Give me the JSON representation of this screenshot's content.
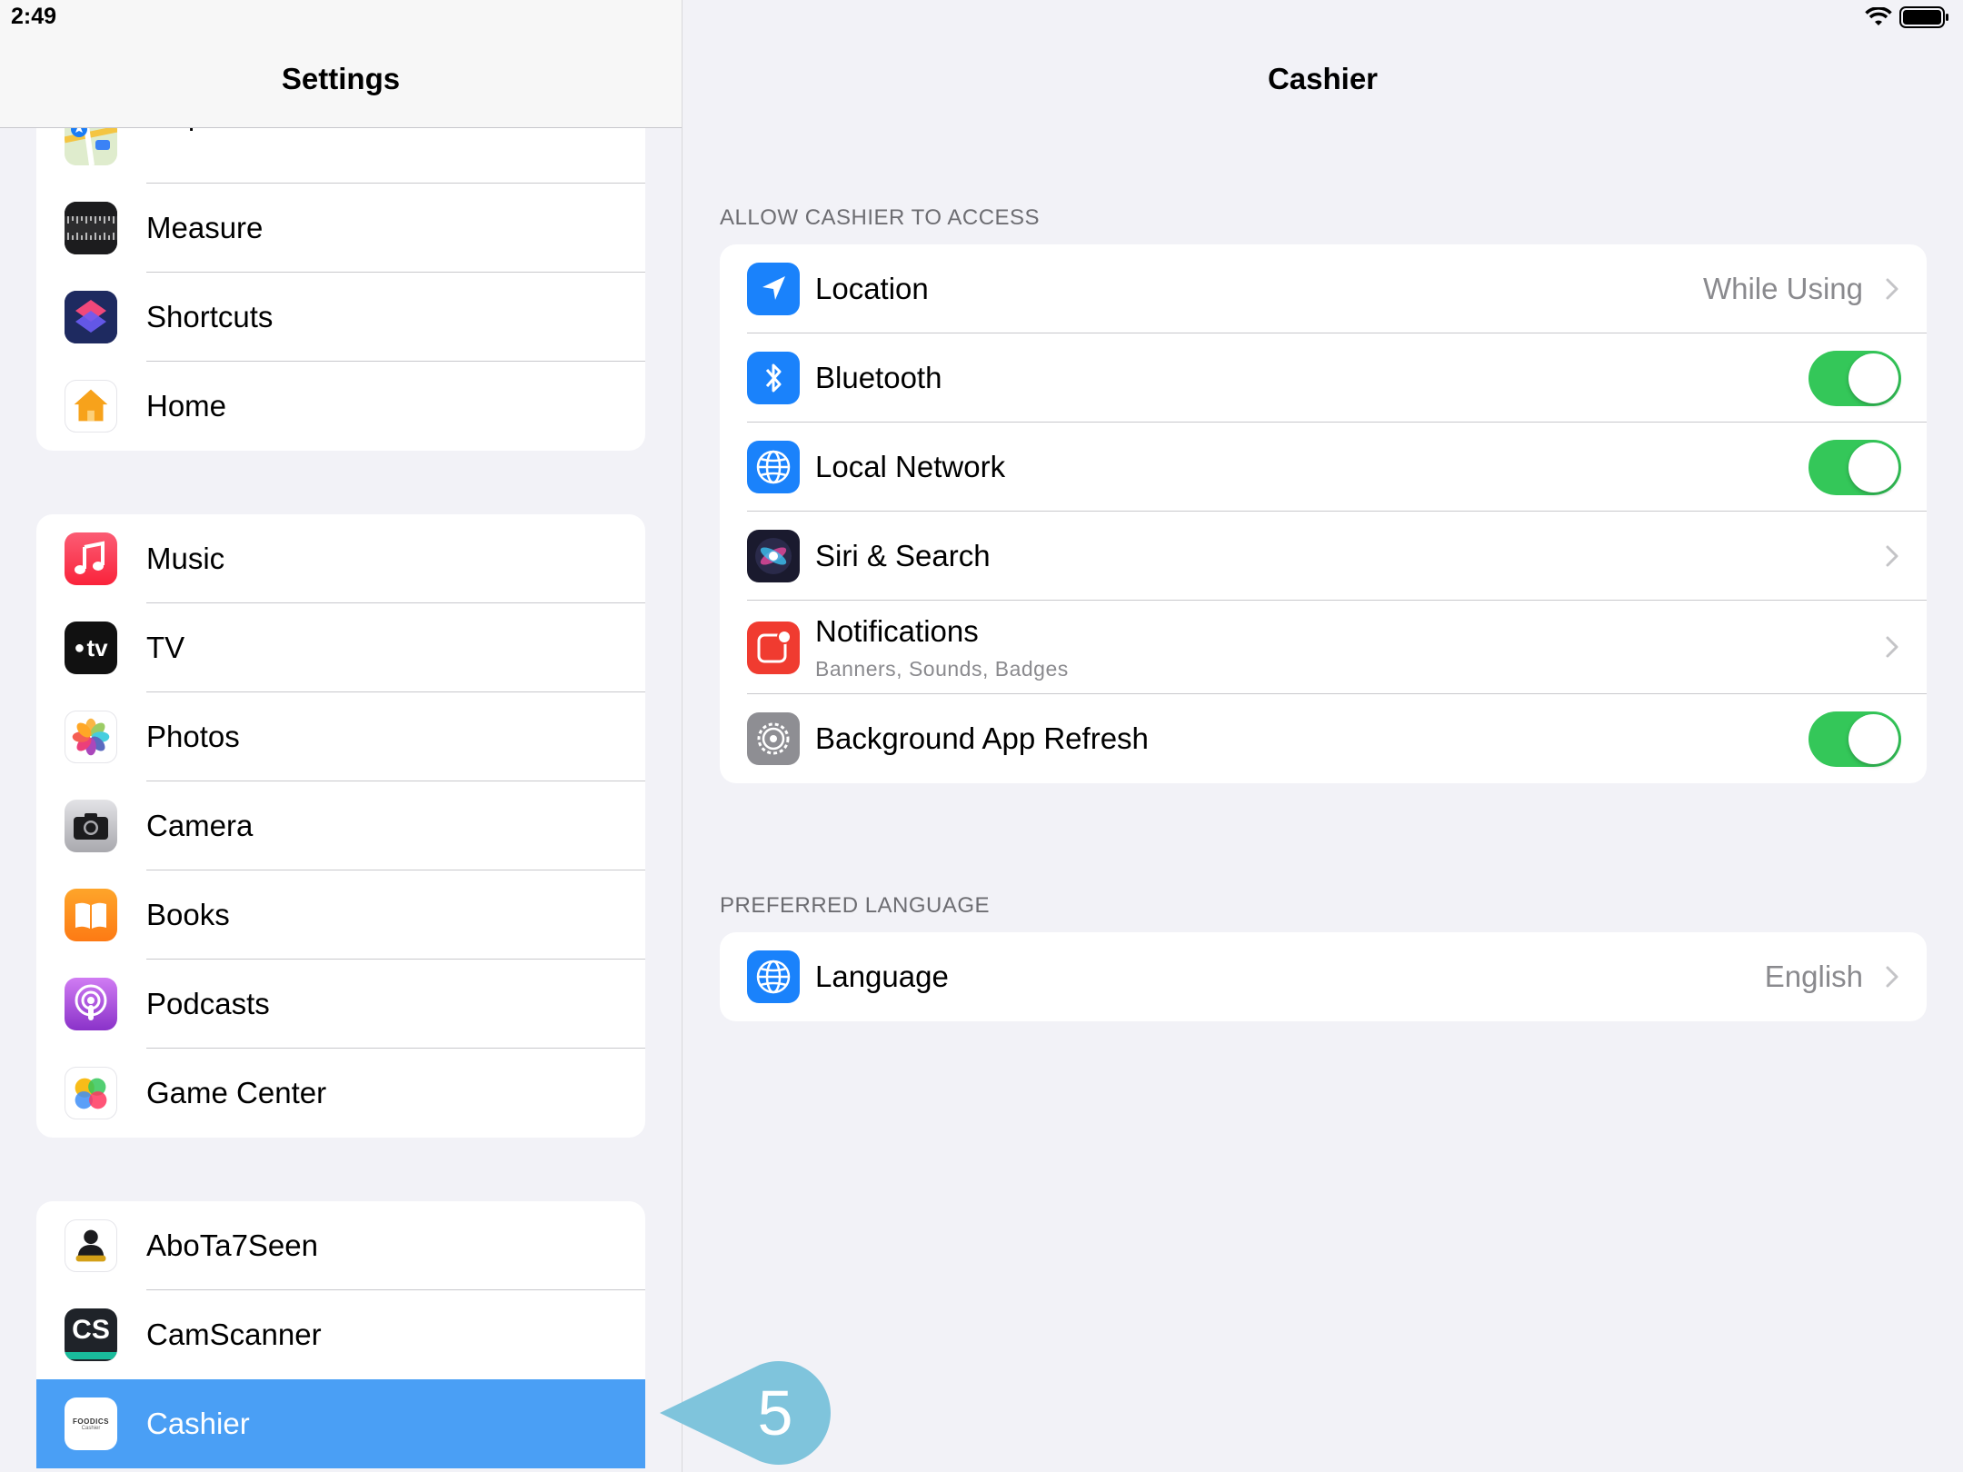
{
  "status_bar": {
    "time": "2:49"
  },
  "sidebar": {
    "title": "Settings",
    "groups": [
      {
        "items": [
          {
            "label": "Maps",
            "icon": "maps-icon"
          },
          {
            "label": "Measure",
            "icon": "measure-icon"
          },
          {
            "label": "Shortcuts",
            "icon": "shortcuts-icon"
          },
          {
            "label": "Home",
            "icon": "home-icon"
          }
        ]
      },
      {
        "items": [
          {
            "label": "Music",
            "icon": "music-icon"
          },
          {
            "label": "TV",
            "icon": "tv-icon",
            "icon_text": "tv"
          },
          {
            "label": "Photos",
            "icon": "photos-icon"
          },
          {
            "label": "Camera",
            "icon": "camera-icon"
          },
          {
            "label": "Books",
            "icon": "books-icon"
          },
          {
            "label": "Podcasts",
            "icon": "podcasts-icon"
          },
          {
            "label": "Game Center",
            "icon": "game-center-icon"
          }
        ]
      },
      {
        "items": [
          {
            "label": "AboTa7Seen",
            "icon": "abota7seen-icon"
          },
          {
            "label": "CamScanner",
            "icon": "camscanner-icon",
            "icon_text": "CS"
          },
          {
            "label": "Cashier",
            "icon": "cashier-icon",
            "icon_text": "FOODICS",
            "icon_subtext": "Cashier",
            "selected": true
          }
        ]
      }
    ]
  },
  "detail": {
    "title": "Cashier",
    "sections": [
      {
        "header": "ALLOW CASHIER TO ACCESS",
        "rows": [
          {
            "label": "Location",
            "icon": "location-arrow-icon",
            "value": "While Using",
            "accessory": "chevron"
          },
          {
            "label": "Bluetooth",
            "icon": "bluetooth-icon",
            "accessory": "toggle",
            "on": true
          },
          {
            "label": "Local Network",
            "icon": "globe-network-icon",
            "accessory": "toggle",
            "on": true
          },
          {
            "label": "Siri & Search",
            "icon": "siri-icon",
            "accessory": "chevron"
          },
          {
            "label": "Notifications",
            "sublabel": "Banners, Sounds, Badges",
            "icon": "notifications-icon",
            "accessory": "chevron"
          },
          {
            "label": "Background App Refresh",
            "icon": "gear-icon",
            "accessory": "toggle",
            "on": true
          }
        ]
      },
      {
        "header": "PREFERRED LANGUAGE",
        "rows": [
          {
            "label": "Language",
            "icon": "globe-icon",
            "value": "English",
            "accessory": "chevron"
          }
        ]
      }
    ]
  },
  "callout": {
    "number": "5",
    "color": "#7fc4dc"
  },
  "colors": {
    "selection": "#4a9ff5",
    "toggle_on": "#34c759",
    "system_blue": "#1a82fb"
  }
}
